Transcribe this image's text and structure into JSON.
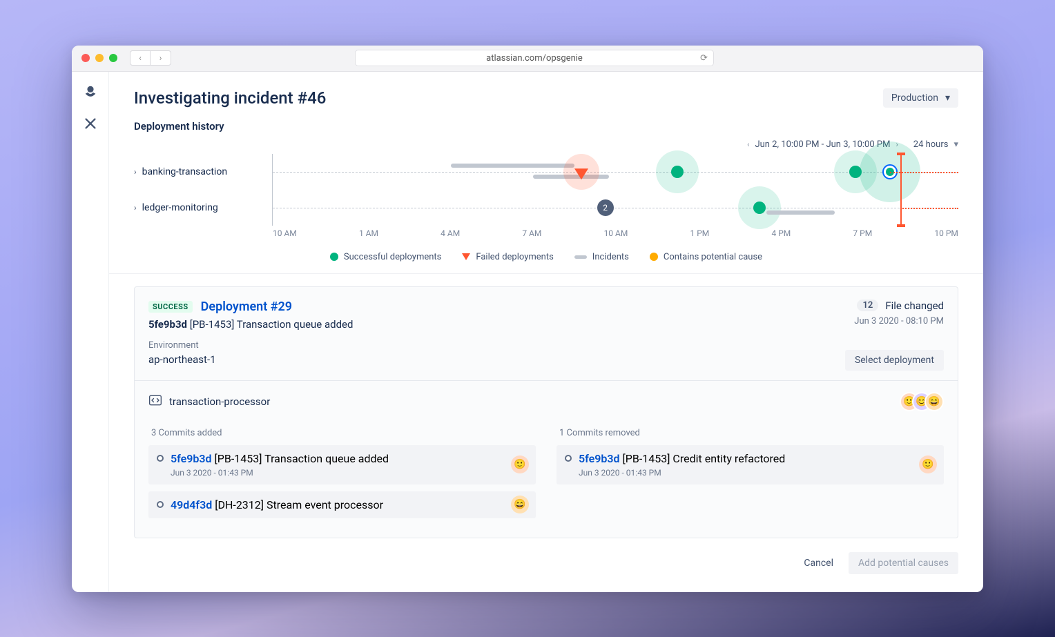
{
  "browser": {
    "url": "atlassian.com/opsgenie"
  },
  "page": {
    "title": "Investigating incident #46",
    "env_selector": "Production",
    "section": "Deployment history",
    "time_range": "Jun 2, 10:00 PM - Jun 3, 10:00 PM",
    "time_window": "24 hours",
    "rows": [
      "banking-transaction",
      "ledger-monitoring"
    ],
    "axis": [
      "10 AM",
      "1 AM",
      "4 AM",
      "7 AM",
      "10 AM",
      "1 PM",
      "4 PM",
      "7 PM",
      "10 PM"
    ],
    "cluster_count": "2",
    "legend": {
      "success": "Successful deployments",
      "failed": "Failed deployments",
      "incidents": "Incidents",
      "potential": "Contains potential cause"
    }
  },
  "deployment": {
    "status": "SUCCESS",
    "title": "Deployment #29",
    "hash": "5fe9b3d",
    "message": "[PB-1453] Transaction queue added",
    "env_label": "Environment",
    "env_value": "ap-northeast-1",
    "files_changed_count": "12",
    "files_changed_label": "File changed",
    "timestamp": "Jun 3 2020 - 08:10 PM",
    "select_button": "Select deployment",
    "repo": "transaction-processor",
    "added_label": "3 Commits added",
    "removed_label": "1 Commits removed",
    "added": [
      {
        "hash": "5fe9b3d",
        "msg": "[PB-1453] Transaction queue added",
        "ts": "Jun 3 2020 - 01:43 PM"
      },
      {
        "hash": "49d4f3d",
        "msg": "[DH-2312] Stream event processor",
        "ts": ""
      }
    ],
    "removed": [
      {
        "hash": "5fe9b3d",
        "msg": "[PB-1453] Credit entity refactored",
        "ts": "Jun 3 2020 - 01:43 PM"
      }
    ]
  },
  "footer": {
    "cancel": "Cancel",
    "add": "Add potential causes"
  }
}
